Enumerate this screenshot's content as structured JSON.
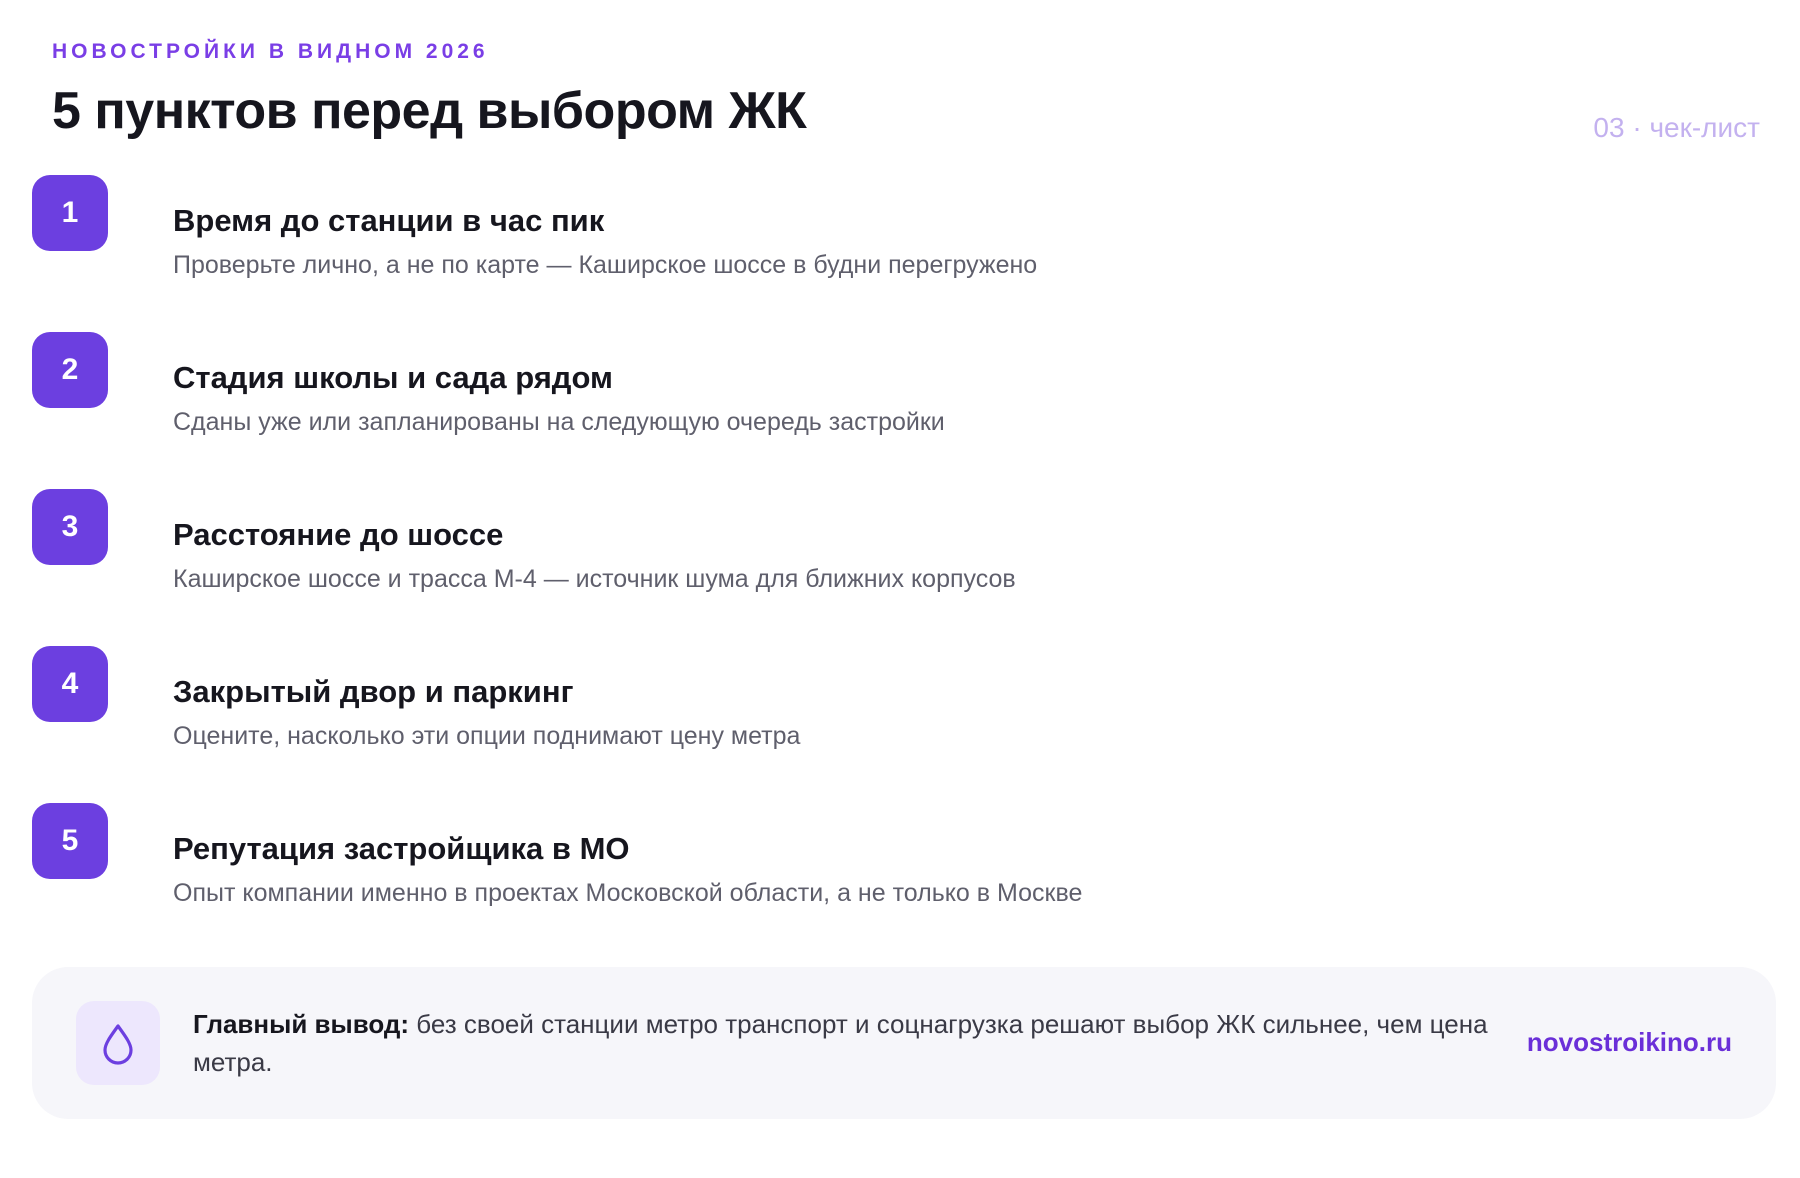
{
  "header": {
    "eyebrow": "НОВОСТРОЙКИ В ВИДНОМ 2026",
    "title": "5 пунктов перед выбором ЖК",
    "page_tag": "03 · чек-лист"
  },
  "checklist": [
    {
      "number": "1",
      "title": "Время до станции в час пик",
      "description": "Проверьте лично, а не по карте — Каширское шоссе в будни перегружено"
    },
    {
      "number": "2",
      "title": "Стадия школы и сада рядом",
      "description": "Сданы уже или запланированы на следующую очередь застройки"
    },
    {
      "number": "3",
      "title": "Расстояние до шоссе",
      "description": "Каширское шоссе и трасса М-4 — источник шума для ближних корпусов"
    },
    {
      "number": "4",
      "title": "Закрытый двор и паркинг",
      "description": "Оцените, насколько эти опции поднимают цену метра"
    },
    {
      "number": "5",
      "title": "Репутация застройщика в МО",
      "description": "Опыт компании именно в проектах Московской области, а не только в Москве"
    }
  ],
  "conclusion": {
    "icon": "drop-icon",
    "lead": "Главный вывод:",
    "text": " без своей станции метро транспорт и соцнагрузка решают выбор ЖК сильнее, чем цена метра.",
    "site": "novostroikino.ru"
  },
  "colors": {
    "accent": "#6c3fe0",
    "eyebrow": "#7a3ee6",
    "page_tag": "#c3b1ef",
    "card_background": "#f6f6fa",
    "icon_background": "#ede7fd"
  }
}
